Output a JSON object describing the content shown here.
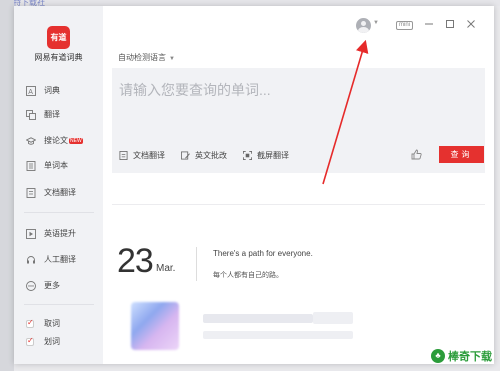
{
  "background": {
    "top_text": "福特下载社"
  },
  "app": {
    "logo_text": "有道",
    "name": "网易有道词典",
    "accent": "#e5312f"
  },
  "sidebar": {
    "items": [
      {
        "label": "词典",
        "icon": "dictionary-icon"
      },
      {
        "label": "翻译",
        "icon": "translate-icon"
      },
      {
        "label": "搜论文",
        "icon": "graduation-cap-icon",
        "badge": "NEW"
      },
      {
        "label": "单词本",
        "icon": "wordbook-icon"
      },
      {
        "label": "文档翻译",
        "icon": "document-icon"
      }
    ],
    "items2": [
      {
        "label": "英语提升",
        "icon": "play-icon"
      },
      {
        "label": "人工翻译",
        "icon": "headset-icon"
      },
      {
        "label": "更多",
        "icon": "more-icon"
      }
    ],
    "checks": [
      {
        "label": "取词",
        "checked": true
      },
      {
        "label": "划词",
        "checked": true
      }
    ]
  },
  "header": {
    "mini_label": "mini"
  },
  "main": {
    "detect_label": "自动检测语言",
    "input_placeholder": "请输入您要查询的单词...",
    "input_value": "",
    "tools": [
      {
        "label": "文档翻译",
        "icon": "doc-translate-icon"
      },
      {
        "label": "英文批改",
        "icon": "correction-icon"
      },
      {
        "label": "截屏翻译",
        "icon": "screenshot-icon"
      }
    ],
    "query_label": "查询"
  },
  "daily": {
    "day": "23",
    "month": "Mar.",
    "quote_en": "There's a path for everyone.",
    "quote_zh": "每个人都有自己的路。"
  },
  "watermark": {
    "text": "棒奇下载"
  }
}
